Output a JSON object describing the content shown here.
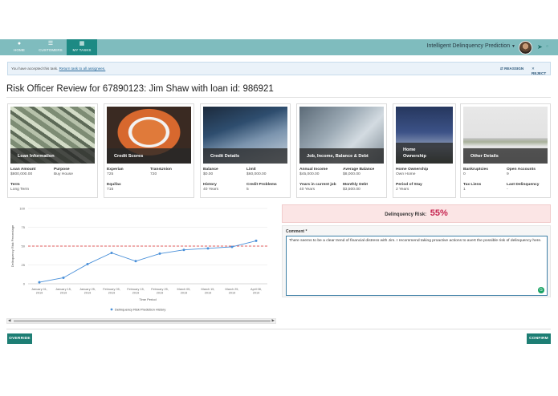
{
  "nav": {
    "tabs": [
      {
        "label": "HOME",
        "icon": "person-icon"
      },
      {
        "label": "CUSTOMERS",
        "icon": "list-icon"
      },
      {
        "label": "MY TASKS",
        "icon": "tasks-icon"
      }
    ],
    "active_tab": "MY TASKS",
    "app_title": "Intelligent Delinquency Prediction",
    "colors": {
      "bar": "#7fbcbe",
      "active": "#1d8a84"
    }
  },
  "notice": {
    "text": "You have accepted this task.",
    "link": "Return task to all assignees.",
    "reassign": "REASSIGN",
    "reject": "REJECT"
  },
  "page_title": "Risk Officer Review for 67890123: Jim Shaw with loan id: 986921",
  "cards": [
    {
      "title": "Loan Information",
      "fields": [
        {
          "k": "Loan Amount",
          "v": "$800,000.00"
        },
        {
          "k": "Purpose",
          "v": "Buy House"
        },
        {
          "k": "Term",
          "v": "Long Term"
        }
      ]
    },
    {
      "title": "Credit Scores",
      "fields": [
        {
          "k": "Experian",
          "v": "725"
        },
        {
          "k": "TransUnion",
          "v": "720"
        },
        {
          "k": "Equifax",
          "v": "715"
        }
      ]
    },
    {
      "title": "Credit Details",
      "fields": [
        {
          "k": "Balance",
          "v": "$0.00"
        },
        {
          "k": "Limit",
          "v": "$60,000.00"
        },
        {
          "k": "History",
          "v": "40 Years"
        },
        {
          "k": "Credit Problems",
          "v": "5"
        }
      ]
    },
    {
      "title": "Job, Income, Balance & Debt",
      "fields": [
        {
          "k": "Annual Income",
          "v": "$45,000.00"
        },
        {
          "k": "Average Balance",
          "v": "$8,000.00"
        },
        {
          "k": "Years in current job",
          "v": "40 Years"
        },
        {
          "k": "Monthly Debt",
          "v": "$3,500.00"
        }
      ]
    },
    {
      "title": "Home Ownership",
      "fields": [
        {
          "k": "Home Ownership",
          "v": "Own Home"
        },
        {
          "k": "Period of Stay",
          "v": "2 Years"
        }
      ]
    },
    {
      "title": "Other Details",
      "fields": [
        {
          "k": "Bankruptcies",
          "v": "0"
        },
        {
          "k": "Open Accounts",
          "v": "9"
        },
        {
          "k": "Tax Liens",
          "v": "1"
        },
        {
          "k": "Last Delinquency",
          "v": "-"
        }
      ]
    }
  ],
  "chart_data": {
    "type": "line",
    "x": [
      "January 01, 2019",
      "January 15, 2019",
      "January 25, 2019",
      "February 05, 2019",
      "February 15, 2019",
      "February 25, 2019",
      "March 05, 2019",
      "March 15, 2019",
      "March 25, 2019",
      "April 08, 2019"
    ],
    "series": [
      {
        "name": "Delinquency Risk Prediction History",
        "values": [
          2,
          8,
          26,
          41,
          30,
          40,
          45,
          47,
          49,
          57
        ]
      }
    ],
    "threshold": 50,
    "ylabel": "Delinquency Risk Percentage",
    "xlabel": "Time Period",
    "yticks": [
      0,
      25,
      50,
      75,
      100
    ],
    "ylim": [
      0,
      100
    ],
    "legend": "bottom-center",
    "colors": {
      "line": "#4a90d9",
      "threshold": "#e05c5c"
    }
  },
  "risk": {
    "label": "Delinquency Risk:",
    "value": "55%",
    "color": "#c62550"
  },
  "comment": {
    "label": "Comment *",
    "text": "There seems to be a clear trend of financial distress with Jim. I recommend taking proactive actions to avert the possible risk of delinquency here."
  },
  "buttons": {
    "override": "OVERRIDE",
    "confirm": "CONFIRM"
  }
}
